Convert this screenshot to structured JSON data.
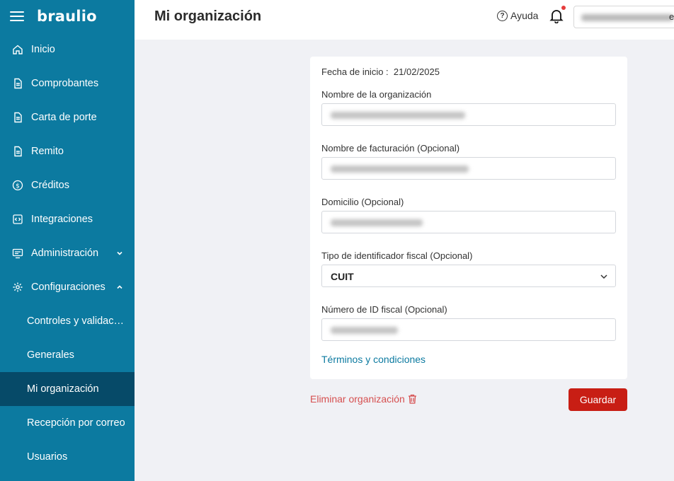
{
  "app": {
    "logo": "braulio"
  },
  "sidebar": {
    "items": [
      {
        "label": "Inicio",
        "icon": "home-icon"
      },
      {
        "label": "Comprobantes",
        "icon": "document-icon"
      },
      {
        "label": "Carta de porte",
        "icon": "document-icon"
      },
      {
        "label": "Remito",
        "icon": "document-icon"
      },
      {
        "label": "Créditos",
        "icon": "dollar-circle-icon"
      },
      {
        "label": "Integraciones",
        "icon": "code-icon"
      },
      {
        "label": "Administración",
        "icon": "monitor-icon",
        "expanded": false
      },
      {
        "label": "Configuraciones",
        "icon": "gear-icon",
        "expanded": true
      }
    ],
    "sub_items": [
      {
        "label": "Controles y validaciones"
      },
      {
        "label": "Generales"
      },
      {
        "label": "Mi organización",
        "active": true
      },
      {
        "label": "Recepción por correo"
      },
      {
        "label": "Usuarios"
      }
    ]
  },
  "header": {
    "title": "Mi organización",
    "help_label": "Ayuda",
    "user_tail": "er"
  },
  "form": {
    "start_date_label": "Fecha de inicio :",
    "start_date_value": "21/02/2025",
    "org_name_label": "Nombre de la organización",
    "billing_name_label": "Nombre de facturación (Opcional)",
    "address_label": "Domicilio (Opcional)",
    "tax_id_type_label": "Tipo de identificador fiscal (Opcional)",
    "tax_id_type_value": "CUIT",
    "tax_id_number_label": "Número de ID fiscal (Opcional)",
    "terms_link": "Términos y condiciones"
  },
  "actions": {
    "delete_label": "Eliminar organización",
    "save_label": "Guardar"
  },
  "colors": {
    "sidebar_bg": "#0c7aa0",
    "sidebar_active_bg": "#064a68",
    "primary_button": "#c81e14",
    "danger_text": "#d65050",
    "link": "#0c7aa0",
    "notification_dot": "#e63c3c"
  }
}
